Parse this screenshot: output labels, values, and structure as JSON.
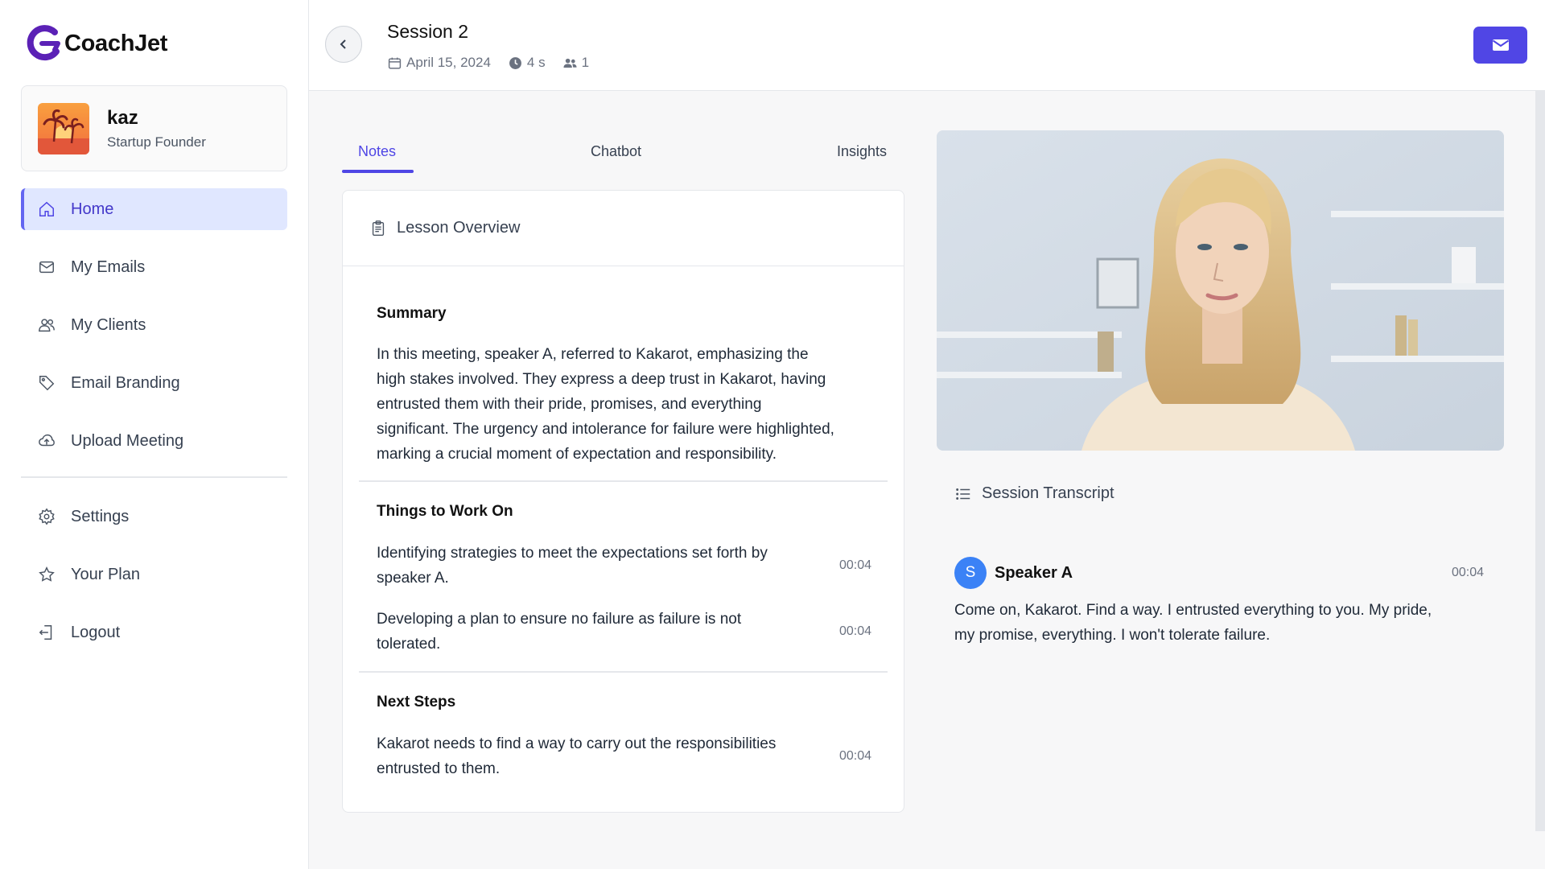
{
  "app": {
    "brand": "CoachJet",
    "colors": {
      "accent": "#4f46e5",
      "button": "#5046e5",
      "speaker_avatar": "#3b82f6"
    }
  },
  "profile": {
    "name": "kaz",
    "role": "Startup Founder",
    "avatar_icon": "palm-tree-sunset-avatar"
  },
  "sidebar": {
    "items": [
      {
        "label": "Home",
        "icon": "home-icon",
        "active": true
      },
      {
        "label": "My Emails",
        "icon": "mail-icon"
      },
      {
        "label": "My Clients",
        "icon": "users-icon"
      },
      {
        "label": "Email Branding",
        "icon": "tag-icon"
      },
      {
        "label": "Upload Meeting",
        "icon": "cloud-upload-icon"
      },
      {
        "label": "Settings",
        "icon": "gear-icon"
      },
      {
        "label": "Your Plan",
        "icon": "star-icon"
      },
      {
        "label": "Logout",
        "icon": "logout-icon"
      }
    ]
  },
  "header": {
    "title": "Session 2",
    "date": "April 15, 2024",
    "duration": "4 s",
    "participants": "1"
  },
  "tabs": [
    {
      "label": "Notes",
      "active": true
    },
    {
      "label": "Chatbot"
    },
    {
      "label": "Insights"
    }
  ],
  "notes": {
    "heading": "Lesson Overview",
    "summary_title": "Summary",
    "summary_lines": [
      "In this meeting, speaker A, referred to Kakarot, emphasizing the",
      "high stakes involved. They express a deep trust in Kakarot, having",
      "entrusted them with their pride, promises, and everything",
      "significant. The urgency and intolerance for failure were highlighted,",
      "marking a crucial moment of expectation and responsibility."
    ],
    "work_title": "Things to Work On",
    "work_items": [
      {
        "lines": [
          "Identifying strategies to meet the expectations set forth by",
          "speaker A."
        ],
        "time": "00:04"
      },
      {
        "lines": [
          "Developing a plan to ensure no failure as failure is not",
          "tolerated."
        ],
        "time": "00:04"
      }
    ],
    "next_title": "Next Steps",
    "next_items": [
      {
        "lines": [
          "Kakarot needs to find a way to carry out the responsibilities",
          "entrusted to them."
        ],
        "time": "00:04"
      }
    ]
  },
  "transcript": {
    "heading": "Session Transcript",
    "entries": [
      {
        "initial": "S",
        "speaker": "Speaker A",
        "time": "00:04",
        "lines": [
          "Come on, Kakarot. Find a way. I entrusted everything to you. My pride,",
          "my promise, everything. I won't tolerate failure."
        ]
      }
    ]
  }
}
